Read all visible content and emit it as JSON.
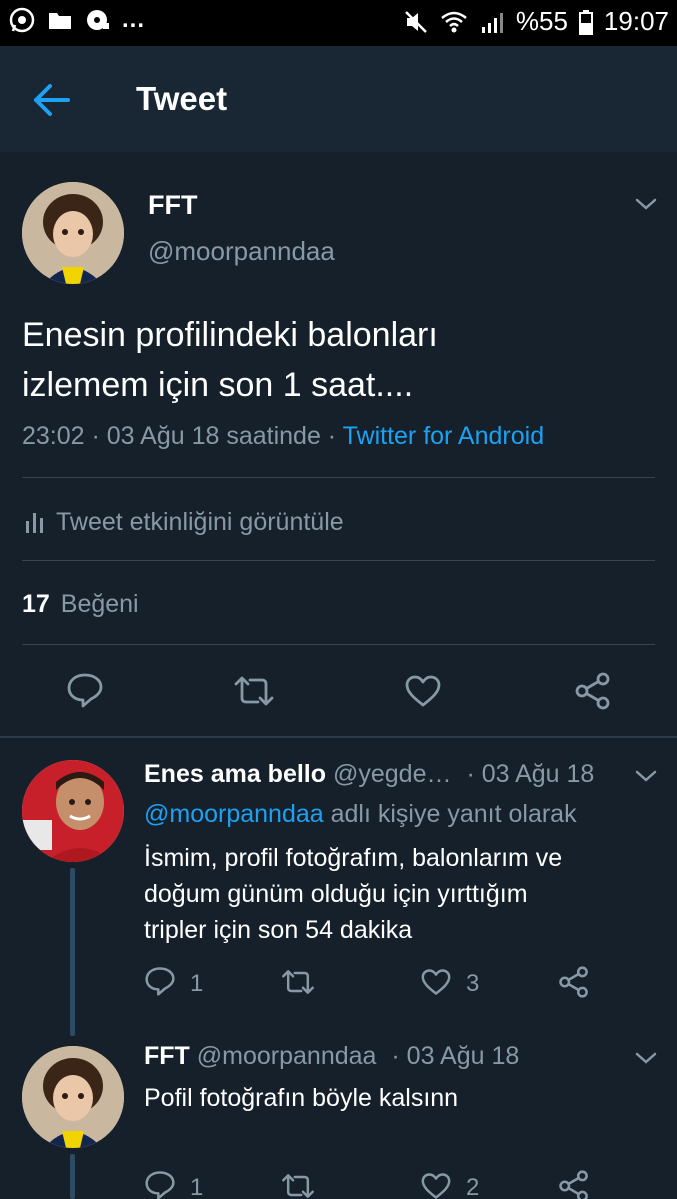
{
  "status_bar": {
    "battery": "%55",
    "time": "19:07",
    "more": "..."
  },
  "header": {
    "title": "Tweet"
  },
  "main_tweet": {
    "author_name": "FFT",
    "author_handle": "@moorpanndaa",
    "text_line1": "Enesin profilindeki balonları",
    "text_line2": "izlemem için son 1 saat....",
    "timestamp": "23:02 · 03 Ağu 18 saatinde ·",
    "source": "Twitter for Android",
    "activity_label": "Tweet etkinliğini görüntüle",
    "likes_count": "17",
    "likes_label": "Beğeni"
  },
  "replies": [
    {
      "author_name": "Enes ama bello",
      "author_handle": "@yegde…",
      "date": "· 03 Ağu 18",
      "reply_to_handle": "@moorpanndaa",
      "reply_to_suffix": "adlı kişiye yanıt olarak",
      "text_line1": "İsmim, profil fotoğrafım, balonlarım ve",
      "text_line2": "doğum günüm olduğu için yırttığım",
      "text_line3": "tripler için son 54 dakika",
      "reply_count": "1",
      "like_count": "3"
    },
    {
      "author_name": "FFT",
      "author_handle": "@moorpanndaa",
      "date": "· 03 Ağu 18",
      "text_line1": "Pofil fotoğrafın böyle kalsınn",
      "reply_count": "1",
      "like_count": "2"
    }
  ],
  "colors": {
    "background": "#15202b",
    "header": "#192734",
    "accent": "#1da1f2",
    "muted": "#8899a6",
    "divider": "#38444d"
  }
}
